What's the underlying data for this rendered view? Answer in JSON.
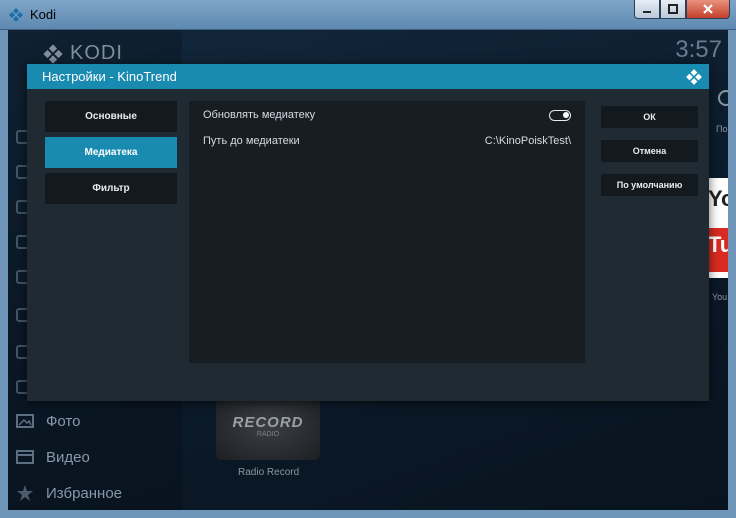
{
  "window": {
    "title": "Kodi"
  },
  "kodi": {
    "brand": "KODI",
    "clock": "3:57",
    "menu": [
      {
        "label": "Фото",
        "icon": "photo-icon"
      },
      {
        "label": "Видео",
        "icon": "video-icon"
      },
      {
        "label": "Избранное",
        "icon": "star-icon"
      }
    ],
    "radio_tile": {
      "logo_text": "RECORD",
      "logo_sub": "RADIO",
      "caption": "Radio Record"
    },
    "peek": {
      "yt_letters": "Yo",
      "yt_red_letters": "Tu",
      "label": "You",
      "label2": "По"
    }
  },
  "dialog": {
    "title": "Настройки - KinoTrend",
    "categories": [
      {
        "label": "Основные",
        "active": false
      },
      {
        "label": "Медиатека",
        "active": true
      },
      {
        "label": "Фильтр",
        "active": false
      }
    ],
    "settings": [
      {
        "label": "Обновлять медиатеку",
        "type": "toggle",
        "value": true
      },
      {
        "label": "Путь до медиатеки",
        "type": "text",
        "value": "C:\\KinoPoiskTest\\"
      }
    ],
    "actions": {
      "ok": "ОК",
      "cancel": "Отмена",
      "default": "По умолчанию"
    }
  },
  "colors": {
    "accent": "#1a8bb0",
    "dialog_bg": "#202a33",
    "panel_bg": "#161e24"
  }
}
